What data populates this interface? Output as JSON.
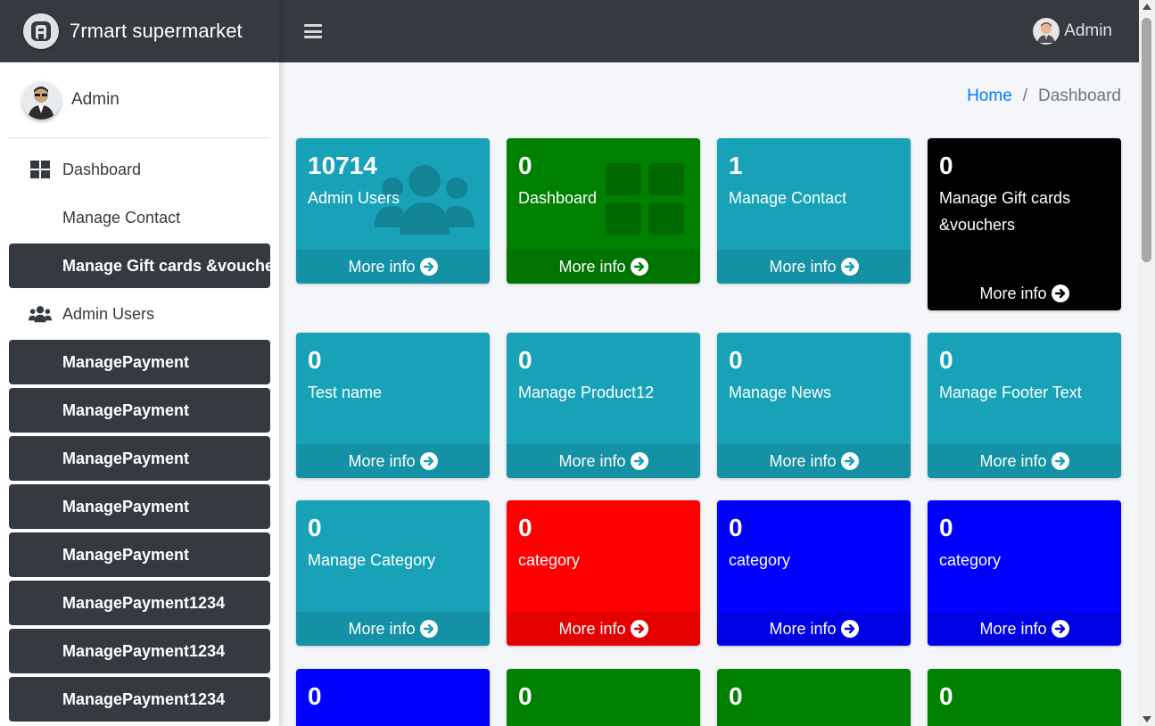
{
  "brand": {
    "title": "7rmart supermarket",
    "logo_icon": "adminlte-logo-icon"
  },
  "sidebar_user": {
    "name": "Admin"
  },
  "sidebar": {
    "items": [
      {
        "label": "Dashboard",
        "icon": "dashboard-grid-icon",
        "style": "icon",
        "caret": true
      },
      {
        "label": "Manage Contact",
        "style": "plain"
      },
      {
        "label": "Manage Gift cards &vouchers",
        "style": "dark"
      },
      {
        "label": "Admin Users",
        "icon": "users-icon",
        "style": "icon",
        "caret": true
      },
      {
        "label": "ManagePayment",
        "style": "dark"
      },
      {
        "label": "ManagePayment",
        "style": "dark"
      },
      {
        "label": "ManagePayment",
        "style": "dark"
      },
      {
        "label": "ManagePayment",
        "style": "dark"
      },
      {
        "label": "ManagePayment",
        "style": "dark"
      },
      {
        "label": "ManagePayment1234",
        "style": "dark"
      },
      {
        "label": "ManagePayment1234",
        "style": "dark"
      },
      {
        "label": "ManagePayment1234",
        "style": "dark"
      }
    ]
  },
  "topbar": {
    "user_name": "Admin",
    "menu_icon": "hamburger-icon"
  },
  "breadcrumb": {
    "home": "Home",
    "separator": "/",
    "active": "Dashboard"
  },
  "boxes": [
    {
      "count": "10714",
      "label": "Admin Users",
      "footer": "More info",
      "color": "#17a2b8",
      "icon": "users-icon"
    },
    {
      "count": "0",
      "label": "Dashboard",
      "footer": "More info",
      "color": "#008000",
      "icon": "dashboard-grid-icon"
    },
    {
      "count": "1",
      "label": "Manage Contact",
      "footer": "More info",
      "color": "#17a2b8"
    },
    {
      "count": "0",
      "label": "Manage Gift cards &vouchers",
      "footer": "More info",
      "color": "#000000"
    },
    {
      "count": "0",
      "label": "Test name",
      "footer": "More info",
      "color": "#17a2b8"
    },
    {
      "count": "0",
      "label": "Manage Product12",
      "footer": "More info",
      "color": "#17a2b8"
    },
    {
      "count": "0",
      "label": "Manage News",
      "footer": "More info",
      "color": "#17a2b8"
    },
    {
      "count": "0",
      "label": "Manage Footer Text",
      "footer": "More info",
      "color": "#17a2b8"
    },
    {
      "count": "0",
      "label": "Manage Category",
      "footer": "More info",
      "color": "#17a2b8"
    },
    {
      "count": "0",
      "label": "category",
      "footer": "More info",
      "color": "#ff0000"
    },
    {
      "count": "0",
      "label": "category",
      "footer": "More info",
      "color": "#0000ff"
    },
    {
      "count": "0",
      "label": "category",
      "footer": "More info",
      "color": "#0000ff"
    },
    {
      "count": "0",
      "color": "#0000ff"
    },
    {
      "count": "0",
      "color": "#008000"
    },
    {
      "count": "0",
      "color": "#008000"
    },
    {
      "count": "0",
      "color": "#008000"
    }
  ]
}
